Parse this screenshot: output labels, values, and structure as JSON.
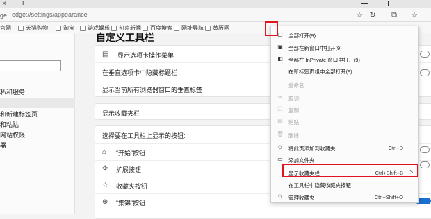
{
  "browser": {
    "tab_close": "×",
    "new_tab": "+",
    "address_prefix": "ge",
    "address_url": "edge://settings/appearance"
  },
  "favorites_bar": [
    {
      "label": "官网"
    },
    {
      "label": "天猫购物"
    },
    {
      "label": "淘宝"
    },
    {
      "label": "游戏娱乐"
    },
    {
      "label": "热点新闻"
    },
    {
      "label": "百度搜索"
    },
    {
      "label": "网址导航"
    },
    {
      "label": "黄历网"
    }
  ],
  "sidenav": {
    "items": [
      {
        "label": "私和服务"
      },
      {
        "label": ""
      },
      {
        "label": "和新建标签页"
      },
      {
        "label": "和粘贴"
      },
      {
        "label": "网站权限"
      },
      {
        "label": "器"
      }
    ]
  },
  "settings": {
    "section_title": "自定义工具栏",
    "rows": {
      "tab_actions": "显示选项卡操作菜单",
      "vertical_hide_title": "在垂直选项卡中隐藏标题栏",
      "vertical_all_windows": "显示当前所有浏览器窗口的垂直标签",
      "show_favorites_bar": "显示收藏夹栏",
      "choose_buttons": "选择要在工具栏上显示的按钮:",
      "home_button": "“开始”按钮",
      "extensions_button": "扩展按钮",
      "favorites_button": "收藏夹按钮",
      "collections_button": "“集锦”按钮"
    }
  },
  "context_menu": {
    "items": [
      {
        "label": "全部打开(9)",
        "shortcut": "",
        "disabled": false,
        "icon": "open-tabs-icon"
      },
      {
        "label": "全部在新窗口中打开(9)",
        "shortcut": "",
        "disabled": false,
        "icon": "new-window-icon"
      },
      {
        "label": "全部在 InPrivate 窗口中打开(9)",
        "shortcut": "",
        "disabled": false,
        "icon": "inprivate-icon"
      },
      {
        "label": "在新标签页组中全部打开(9)",
        "shortcut": "",
        "disabled": false,
        "icon": ""
      },
      {
        "label": "重命名",
        "shortcut": "",
        "disabled": true,
        "icon": ""
      },
      {
        "label": "剪切",
        "shortcut": "",
        "disabled": true,
        "icon": "cut-icon"
      },
      {
        "label": "复制",
        "shortcut": "",
        "disabled": true,
        "icon": "copy-icon"
      },
      {
        "label": "粘贴",
        "shortcut": "",
        "disabled": true,
        "icon": "paste-icon"
      },
      {
        "label": "删除",
        "shortcut": "",
        "disabled": true,
        "icon": "trash-icon"
      },
      {
        "label": "将此页添加到收藏夹",
        "shortcut": "Ctrl+D",
        "disabled": false,
        "icon": "add-favorite-icon"
      },
      {
        "label": "添加文件夹",
        "shortcut": "",
        "disabled": false,
        "icon": "add-folder-icon"
      },
      {
        "label": "显示收藏夹栏",
        "shortcut": "Ctrl+Shift+B",
        "disabled": false,
        "icon": "",
        "arrow": ">"
      },
      {
        "label": "在工具栏中隐藏收藏夹按钮",
        "shortcut": "",
        "disabled": false,
        "icon": ""
      },
      {
        "label": "管理收藏夹",
        "shortcut": "Ctrl+Shift+O",
        "disabled": false,
        "icon": "manage-favorites-icon"
      }
    ]
  },
  "colors": {
    "highlight": "#e0141e",
    "accent": "#1b6fcf"
  }
}
